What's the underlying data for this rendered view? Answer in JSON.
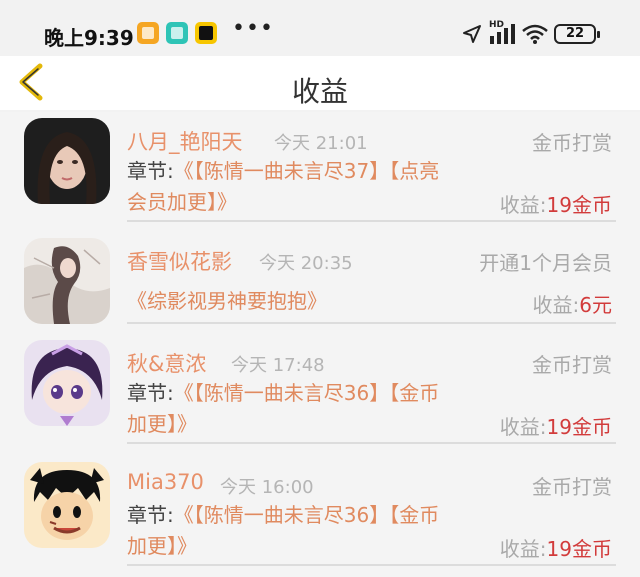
{
  "status_bar": {
    "time": "晚上9:39",
    "dots": "•••",
    "battery": "22",
    "signal_label": "HD"
  },
  "header": {
    "title": "收益"
  },
  "items": [
    {
      "name": "八月_艳阳天",
      "time": "今天 21:01",
      "type": "金币打赏",
      "desc_label": "章节:",
      "desc_line1": "《【陈情一曲未言尽37】【点亮",
      "desc_line2": "会员加更】》",
      "earn_label": "收益:",
      "earn_value": "19金币"
    },
    {
      "name": "香雪似花影",
      "time": "今天 20:35",
      "type": "开通1个月会员",
      "desc_label": "",
      "desc_line1": "《综影视男神要抱抱》",
      "desc_line2": "",
      "earn_label": "收益:",
      "earn_value": "6元"
    },
    {
      "name": "秋&意浓",
      "time": "今天 17:48",
      "type": "金币打赏",
      "desc_label": "章节:",
      "desc_line1": "《【陈情一曲未言尽36】【金币",
      "desc_line2": "加更】》",
      "earn_label": "收益:",
      "earn_value": "19金币"
    },
    {
      "name": "Mia370",
      "time": "今天 16:00",
      "type": "金币打赏",
      "desc_label": "章节:",
      "desc_line1": "《【陈情一曲未言尽36】【金币",
      "desc_line2": "加更】》",
      "earn_label": "收益:",
      "earn_value": "19金币"
    }
  ],
  "colors": {
    "accent": "#e8916a",
    "amount": "#d23b3b",
    "back_arrow": "#d9b400"
  }
}
